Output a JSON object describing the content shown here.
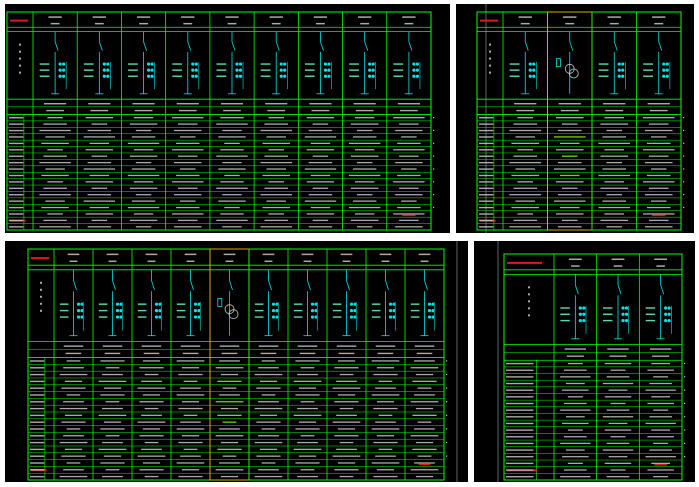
{
  "colors": {
    "background": "#000000",
    "grid": "#00ff00",
    "device": "#00e5e5",
    "device_dot": "#6fffd8",
    "text": "#c8c8c8",
    "title_red": "#ff2020",
    "highlight": "#d4b000",
    "frame": "#7a7a7a",
    "busbar": "#7fff00"
  },
  "sheets": [
    {
      "id": "sheet-1",
      "columns": 9,
      "highlight_column": null
    },
    {
      "id": "sheet-2",
      "columns": 4,
      "highlight_column": 1
    },
    {
      "id": "sheet-3",
      "columns": 10,
      "highlight_column": 4
    },
    {
      "id": "sheet-4",
      "columns": 3,
      "highlight_column": null
    }
  ]
}
